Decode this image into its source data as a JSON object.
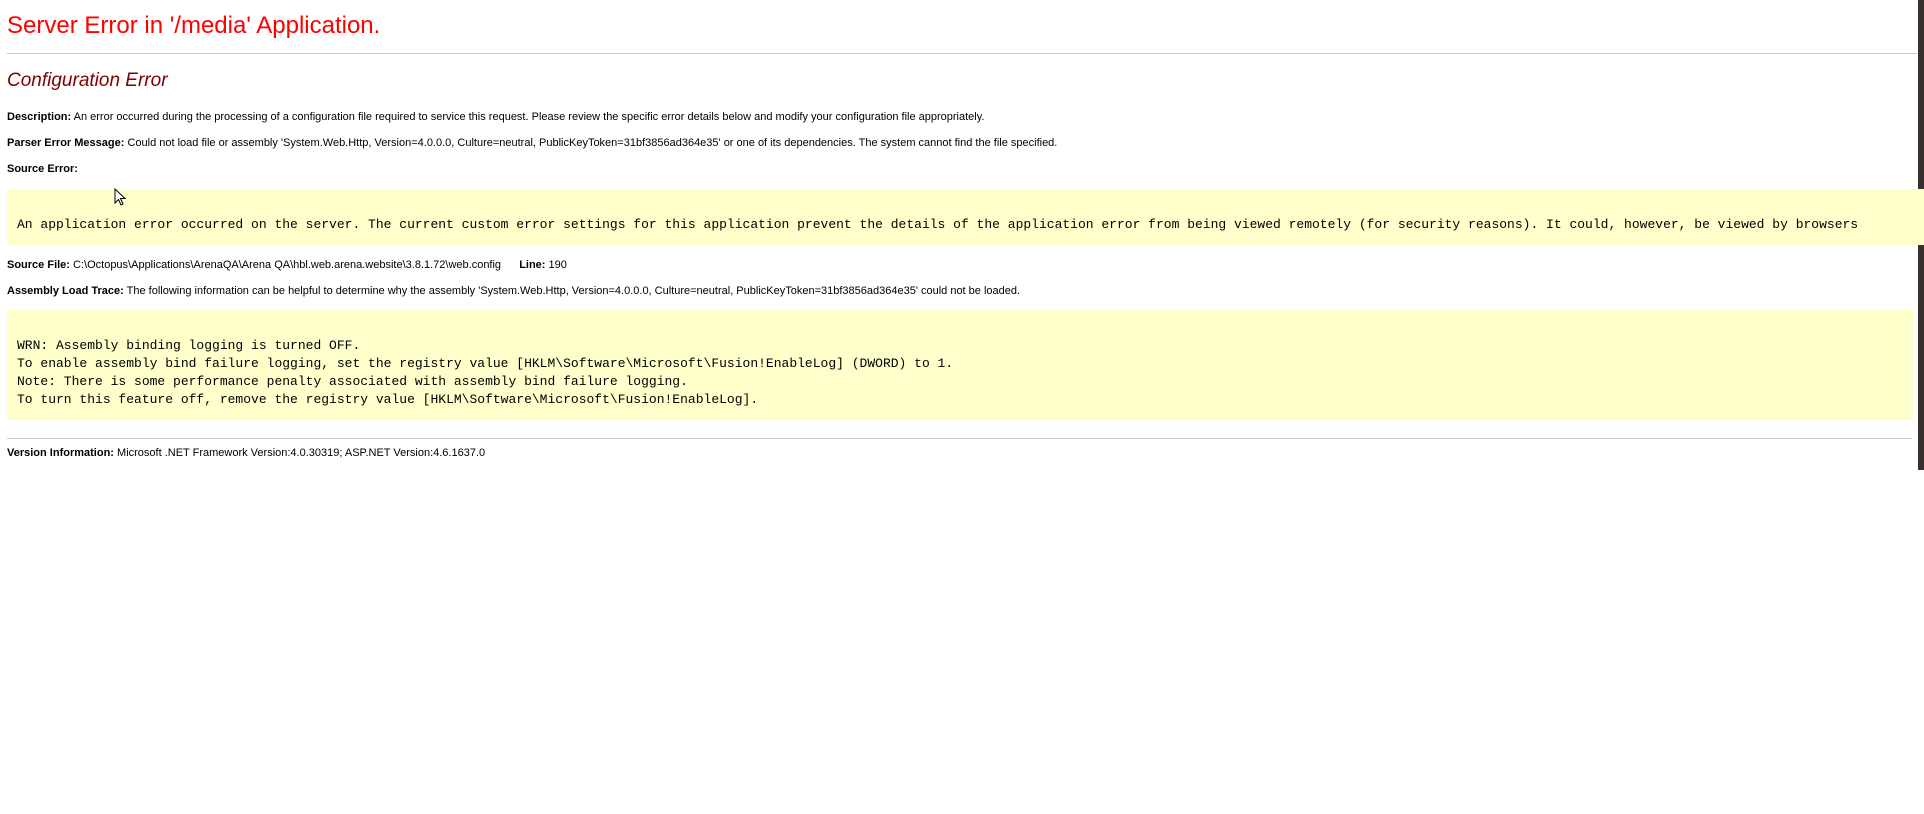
{
  "header": {
    "title": "Server Error in '/media' Application.",
    "subtitle": "Configuration Error"
  },
  "description": {
    "label": "Description:",
    "text": "An error occurred during the processing of a configuration file required to service this request. Please review the specific error details below and modify your configuration file appropriately."
  },
  "parser_error": {
    "label": "Parser Error Message:",
    "text": "Could not load file or assembly 'System.Web.Http, Version=4.0.0.0, Culture=neutral, PublicKeyToken=31bf3856ad364e35' or one of its dependencies. The system cannot find the file specified."
  },
  "source_error": {
    "label": "Source Error:",
    "code": "An application error occurred on the server. The current custom error settings for this application prevent the details of the application error from being viewed remotely (for security reasons). It could, however, be viewed by browsers"
  },
  "source_file": {
    "label": "Source File:",
    "path": "C:\\Octopus\\Applications\\ArenaQA\\Arena QA\\hbl.web.arena.website\\3.8.1.72\\web.config",
    "line_label": "Line:",
    "line_number": "190"
  },
  "assembly_trace": {
    "label": "Assembly Load Trace:",
    "text": "The following information can be helpful to determine why the assembly 'System.Web.Http, Version=4.0.0.0, Culture=neutral, PublicKeyToken=31bf3856ad364e35' could not be loaded.",
    "log_lines": [
      "WRN: Assembly binding logging is turned OFF.",
      "To enable assembly bind failure logging, set the registry value [HKLM\\Software\\Microsoft\\Fusion!EnableLog] (DWORD) to 1.",
      "Note: There is some performance penalty associated with assembly bind failure logging.",
      "To turn this feature off, remove the registry value [HKLM\\Software\\Microsoft\\Fusion!EnableLog]."
    ]
  },
  "version_info": {
    "label": "Version Information:",
    "text": "Microsoft .NET Framework Version:4.0.30319; ASP.NET Version:4.6.1637.0"
  },
  "colors": {
    "title": "#ff0000",
    "subtitle": "#800000",
    "code_background": "#ffffcc"
  },
  "icons": {
    "cursor": "mouse-pointer-icon"
  }
}
